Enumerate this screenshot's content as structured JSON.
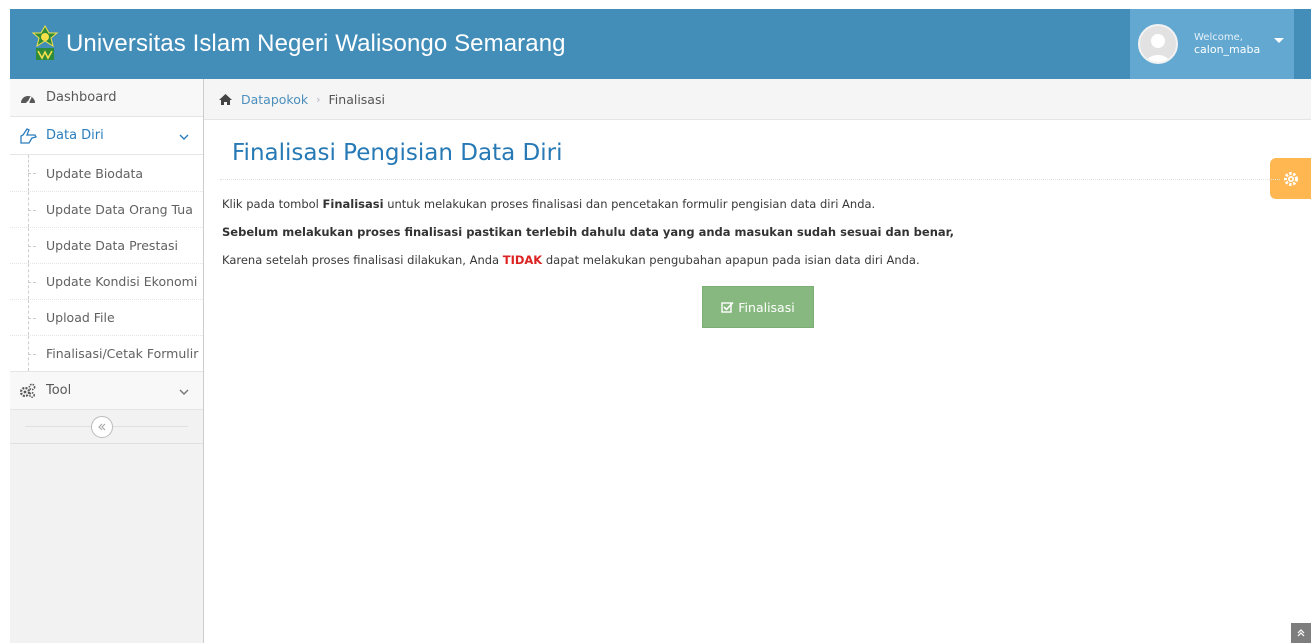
{
  "app": {
    "title": "Universitas Islam Negeri Walisongo Semarang",
    "brand_color": "#438eb9"
  },
  "user": {
    "welcome": "Welcome,",
    "name": "calon_maba"
  },
  "sidebar": {
    "items": [
      {
        "label": "Dashboard",
        "icon": "dashboard-icon"
      },
      {
        "label": "Data Diri",
        "icon": "hand-pointing-icon",
        "active": true
      },
      {
        "label": "Tool",
        "icon": "cogs-icon"
      }
    ],
    "submenu": [
      {
        "label": "Update Biodata"
      },
      {
        "label": "Update Data Orang Tua"
      },
      {
        "label": "Update Data Prestasi"
      },
      {
        "label": "Update Kondisi Ekonomi"
      },
      {
        "label": "Upload File"
      },
      {
        "label": "Finalisasi/Cetak Formulir"
      }
    ]
  },
  "breadcrumb": {
    "parent": "Datapokok",
    "current": "Finalisasi"
  },
  "page": {
    "title": "Finalisasi Pengisian Data Diri",
    "line1_pre": "Klik pada tombol ",
    "line1_bold": "Finalisasi",
    "line1_post": " untuk melakukan proses finalisasi dan pencetakan formulir pengisian data diri Anda.",
    "line2": "Sebelum melakukan proses finalisasi pastikan terlebih dahulu data yang anda masukan sudah sesuai dan benar,",
    "line3_pre": "Karena setelah proses finalisasi dilakukan, Anda ",
    "line3_warn": "TIDAK",
    "line3_post": " dapat melakukan pengubahan apapun pada isian data diri Anda.",
    "button_label": "Finalisasi"
  },
  "colors": {
    "accent": "#2679b5",
    "button": "#87b87f",
    "warning": "#dd2222",
    "settings": "#ffb752"
  }
}
